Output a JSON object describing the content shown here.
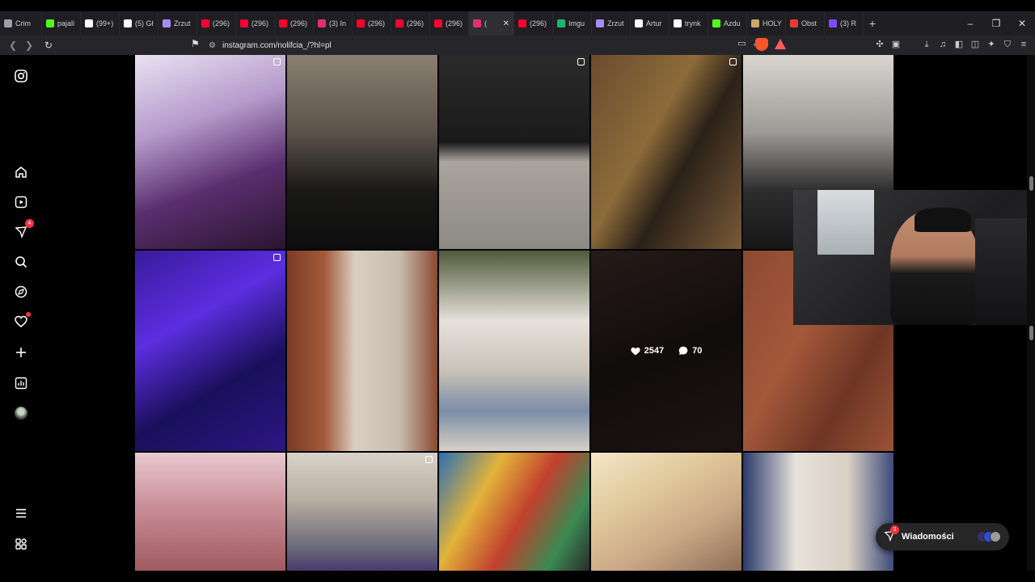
{
  "browser": {
    "tabs": [
      {
        "label": "Crim",
        "color": "#9aa0a6"
      },
      {
        "label": "pajali",
        "color": "#53fc18"
      },
      {
        "label": "(99+)",
        "color": "#ffffff"
      },
      {
        "label": "(5) Gł",
        "color": "#ffffff"
      },
      {
        "label": "Zrzut",
        "color": "#a78bfa"
      },
      {
        "label": "(296)",
        "color": "#ff0033"
      },
      {
        "label": "(296)",
        "color": "#ff0033"
      },
      {
        "label": "(296)",
        "color": "#ff0033"
      },
      {
        "label": "(3) In",
        "color": "#e1306c"
      },
      {
        "label": "(296)",
        "color": "#ff0033"
      },
      {
        "label": "(296)",
        "color": "#ff0033"
      },
      {
        "label": "(296)",
        "color": "#ff0033"
      },
      {
        "label": "(",
        "color": "#e1306c",
        "active": true
      },
      {
        "label": "(296)",
        "color": "#ff0033"
      },
      {
        "label": "Imgu",
        "color": "#1bb76e"
      },
      {
        "label": "Zrzut",
        "color": "#a78bfa"
      },
      {
        "label": "Artur",
        "color": "#ffffff"
      },
      {
        "label": "trynk",
        "color": "#ffffff"
      },
      {
        "label": "Azdu",
        "color": "#53fc18"
      },
      {
        "label": "HOLY",
        "color": "#c9a66b"
      },
      {
        "label": "Obst",
        "color": "#e53935"
      },
      {
        "label": "(3) R",
        "color": "#7c4dff"
      }
    ],
    "url": "instagram.com/nolifcia_/?hl=pl"
  },
  "sidebar": {
    "notifications_badge": "4"
  },
  "grid": {
    "hover_likes": "2547",
    "hover_comments": "70"
  },
  "messages": {
    "label": "Wiadomości",
    "badge": "3"
  }
}
